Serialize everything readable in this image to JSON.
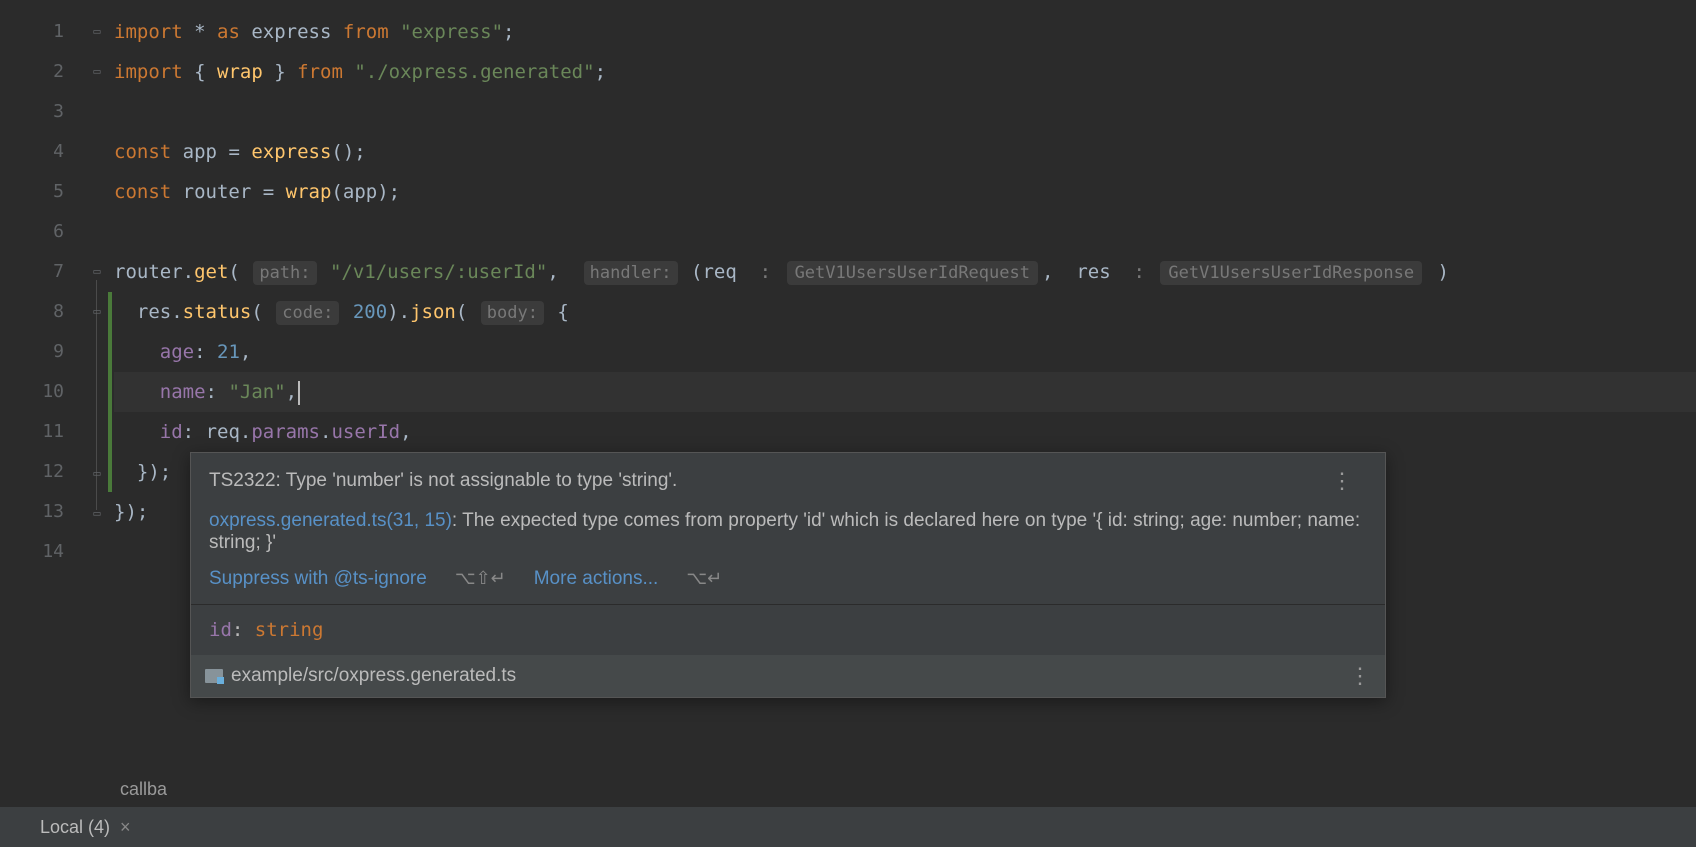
{
  "gutter": {
    "lines": [
      "1",
      "2",
      "3",
      "4",
      "5",
      "6",
      "7",
      "8",
      "9",
      "10",
      "11",
      "12",
      "13",
      "14"
    ]
  },
  "code": {
    "line1": {
      "kw1": "import",
      "star": "*",
      "as": "as",
      "ident": "express",
      "from": "from",
      "str": "\"express\"",
      "semi": ";"
    },
    "line2": {
      "kw1": "import",
      "brace1": "{",
      "ident": "wrap",
      "brace2": "}",
      "from": "from",
      "str": "\"./oxpress.generated\"",
      "semi": ";"
    },
    "line4": {
      "kw": "const",
      "ident": "app",
      "eq": "=",
      "fn": "express",
      "call": "();"
    },
    "line5": {
      "kw": "const",
      "ident": "router",
      "eq": "=",
      "fn": "wrap",
      "open": "(",
      "arg": "app",
      "close": ");"
    },
    "line7": {
      "obj": "router",
      "dot": ".",
      "fn": "get",
      "open": "(",
      "hint1": "path:",
      "path": "\"/v1/users/:userId\"",
      "comma": ",",
      "hint2": "handler:",
      "open2": "(",
      "p1": "req",
      "colon": " : ",
      "t1": "GetV1UsersUserIdRequest",
      "comma2": ",",
      "p2": "res",
      "t2": "GetV1UsersUserIdResponse",
      "close": ")"
    },
    "line8": {
      "obj": "res",
      "dot": ".",
      "fn1": "status",
      "open": "(",
      "hint": "code:",
      "code": "200",
      "close": ")",
      "fn2": "json",
      "open2": "(",
      "hint2": "body:",
      "brace": "{"
    },
    "line9": {
      "prop": "age",
      "colon": ":",
      "val": "21",
      "comma": ","
    },
    "line10": {
      "prop": "name",
      "colon": ":",
      "val": "\"Jan\"",
      "comma": ","
    },
    "line11": {
      "prop": "id",
      "colon": ":",
      "obj": "req",
      "dot1": ".",
      "p2": "params",
      "dot2": ".",
      "p3": "userId",
      "comma": ","
    },
    "line12": {
      "text": "});"
    },
    "line13": {
      "text": "});"
    }
  },
  "tooltip": {
    "error": "TS2322: Type 'number' is not assignable to type 'string'.",
    "source_file": "oxpress.generated.ts(31, 15)",
    "source_msg": ": The expected type comes from property 'id' which is declared here on type '{ id: string; age: number; name: string; }'",
    "action_suppress": "Suppress with @ts-ignore",
    "shortcut_suppress": "⌥⇧↵",
    "action_more": "More actions...",
    "shortcut_more": "⌥↵",
    "type_prop": "id",
    "type_colon": ": ",
    "type_name": "string",
    "file_path": "example/src/oxpress.generated.ts"
  },
  "status": {
    "breadcrumb": "callba"
  },
  "bottom_tab": {
    "label": "Local (4)"
  }
}
